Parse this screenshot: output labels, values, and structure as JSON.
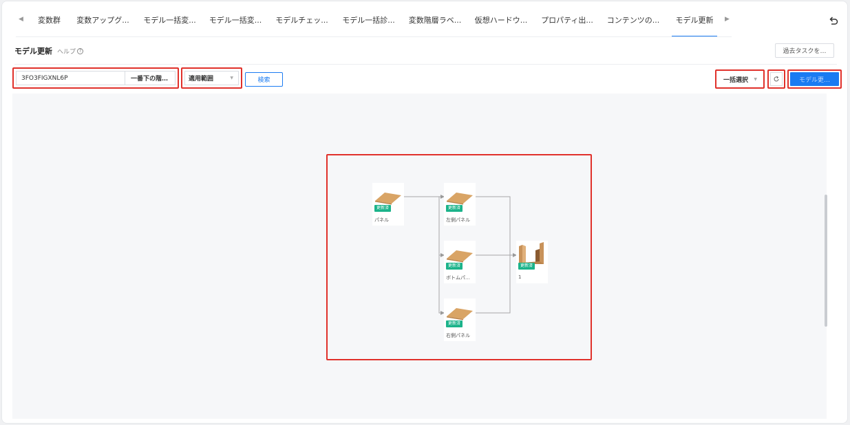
{
  "tabs": [
    {
      "label": "変数群"
    },
    {
      "label": "変数アップグ..."
    },
    {
      "label": "モデル一括変..."
    },
    {
      "label": "モデル一括変..."
    },
    {
      "label": "モデルチェッ..."
    },
    {
      "label": "モデル一括診..."
    },
    {
      "label": "変数階層ラベ..."
    },
    {
      "label": "仮想ハードウ..."
    },
    {
      "label": "プロパティ出..."
    },
    {
      "label": "コンテンツの..."
    },
    {
      "label": "モデル更新"
    }
  ],
  "active_tab": "モデル更新",
  "header": {
    "title": "モデル更新",
    "help_label": "ヘルプ",
    "help_icon": "?",
    "past_tasks_label": "過去タスクを…"
  },
  "toolbar": {
    "model_id_value": "3FO3FIGXNL6P",
    "level_select_label": "一番下の階…",
    "scope_select_label": "適用範囲",
    "search_label": "検索",
    "bulk_select_label": "一括選択",
    "update_label": "モデル更…"
  },
  "graph": {
    "nodes": [
      {
        "id": "panel",
        "label": "パネル",
        "badge": "更新済"
      },
      {
        "id": "left",
        "label": "左側パネル",
        "badge": "更新済"
      },
      {
        "id": "bottom",
        "label": "ボトムパ…",
        "badge": "更新済"
      },
      {
        "id": "right",
        "label": "右側パネル",
        "badge": "更新済"
      },
      {
        "id": "assembly",
        "label": "1",
        "badge": "更新済"
      }
    ]
  },
  "colors": {
    "accent": "#1a7bf2",
    "highlight": "#e0302a",
    "badge": "#1bb38a",
    "wood": "#d9a465"
  }
}
